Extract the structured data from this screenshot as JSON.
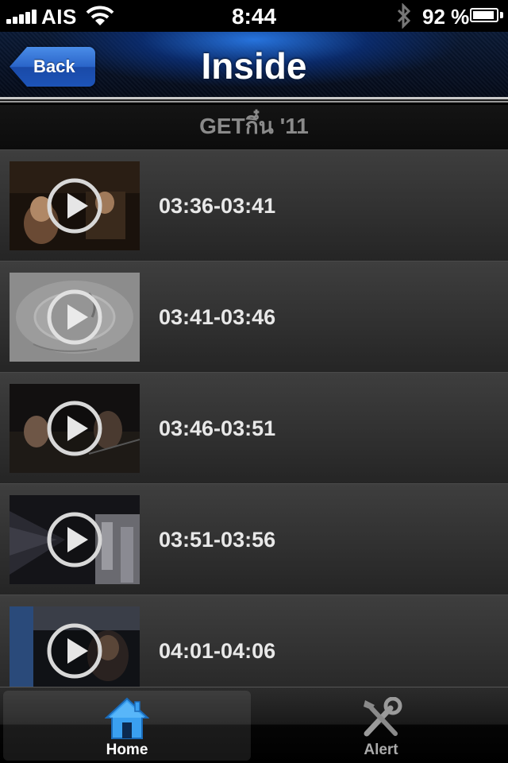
{
  "status_bar": {
    "carrier": "AIS",
    "time": "8:44",
    "battery_percent": "92 %",
    "battery_level": 0.92
  },
  "nav": {
    "back_label": "Back",
    "title": "Inside"
  },
  "section_header": "GETกึ๋น '11",
  "videos": [
    {
      "time_range": "03:36-03:41"
    },
    {
      "time_range": "03:41-03:46"
    },
    {
      "time_range": "03:46-03:51"
    },
    {
      "time_range": "03:51-03:56"
    },
    {
      "time_range": "04:01-04:06"
    }
  ],
  "tabs": [
    {
      "label": "Home",
      "icon": "house-icon",
      "selected": true
    },
    {
      "label": "Alert",
      "icon": "tools-icon",
      "selected": false
    }
  ],
  "colors": {
    "nav_accent": "#1e64d2",
    "home_icon": "#3aa0f0"
  }
}
